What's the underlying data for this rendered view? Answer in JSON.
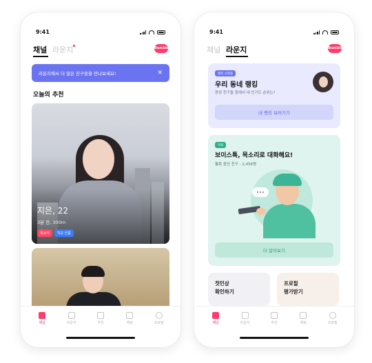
{
  "status": {
    "time": "9:41"
  },
  "brand": {
    "logo_text": "Bumble",
    "accent": "#ff3b6b"
  },
  "left_screen": {
    "tabs": [
      {
        "label": "채널",
        "active": true
      },
      {
        "label": "라운지",
        "active": false
      }
    ],
    "banner": {
      "text": "라운지에서 더 많은 친구들을 만나보세요!"
    },
    "section_title": "오늘의 추천",
    "profile": {
      "name": "지은, 22",
      "meta": "3분 전, 300m",
      "chips": [
        "목소리",
        "학교 인증"
      ]
    }
  },
  "right_screen": {
    "tabs": [
      {
        "label": "채널",
        "active": false
      },
      {
        "label": "라운지",
        "active": true
      }
    ],
    "ranking_card": {
      "pill": "랭킹 신청중",
      "title": "우리 동네 랭킹",
      "subtitle": "동성 친구들 중에서 내 인기도 순위는?",
      "button": "내 랭킹 보러가기"
    },
    "voice_card": {
      "pill": "무료",
      "title": "보이스톡, 목소리로 대화해요!",
      "subtitle": "통화 중인 친구 : 2,456명",
      "button": "더 알아보기"
    },
    "mini_cards": [
      {
        "line1": "첫인상",
        "line2": "확인하기"
      },
      {
        "line1": "프로필",
        "line2": "평가받기"
      }
    ]
  },
  "nav": {
    "items": [
      {
        "label": "채널",
        "icon": "channel-icon",
        "active": true
      },
      {
        "label": "라운지",
        "icon": "lounge-icon",
        "active": false
      },
      {
        "label": "추천",
        "icon": "recommend-icon",
        "active": false
      },
      {
        "label": "채팅",
        "icon": "chat-icon",
        "active": false
      },
      {
        "label": "프로필",
        "icon": "profile-icon",
        "active": false
      }
    ]
  }
}
